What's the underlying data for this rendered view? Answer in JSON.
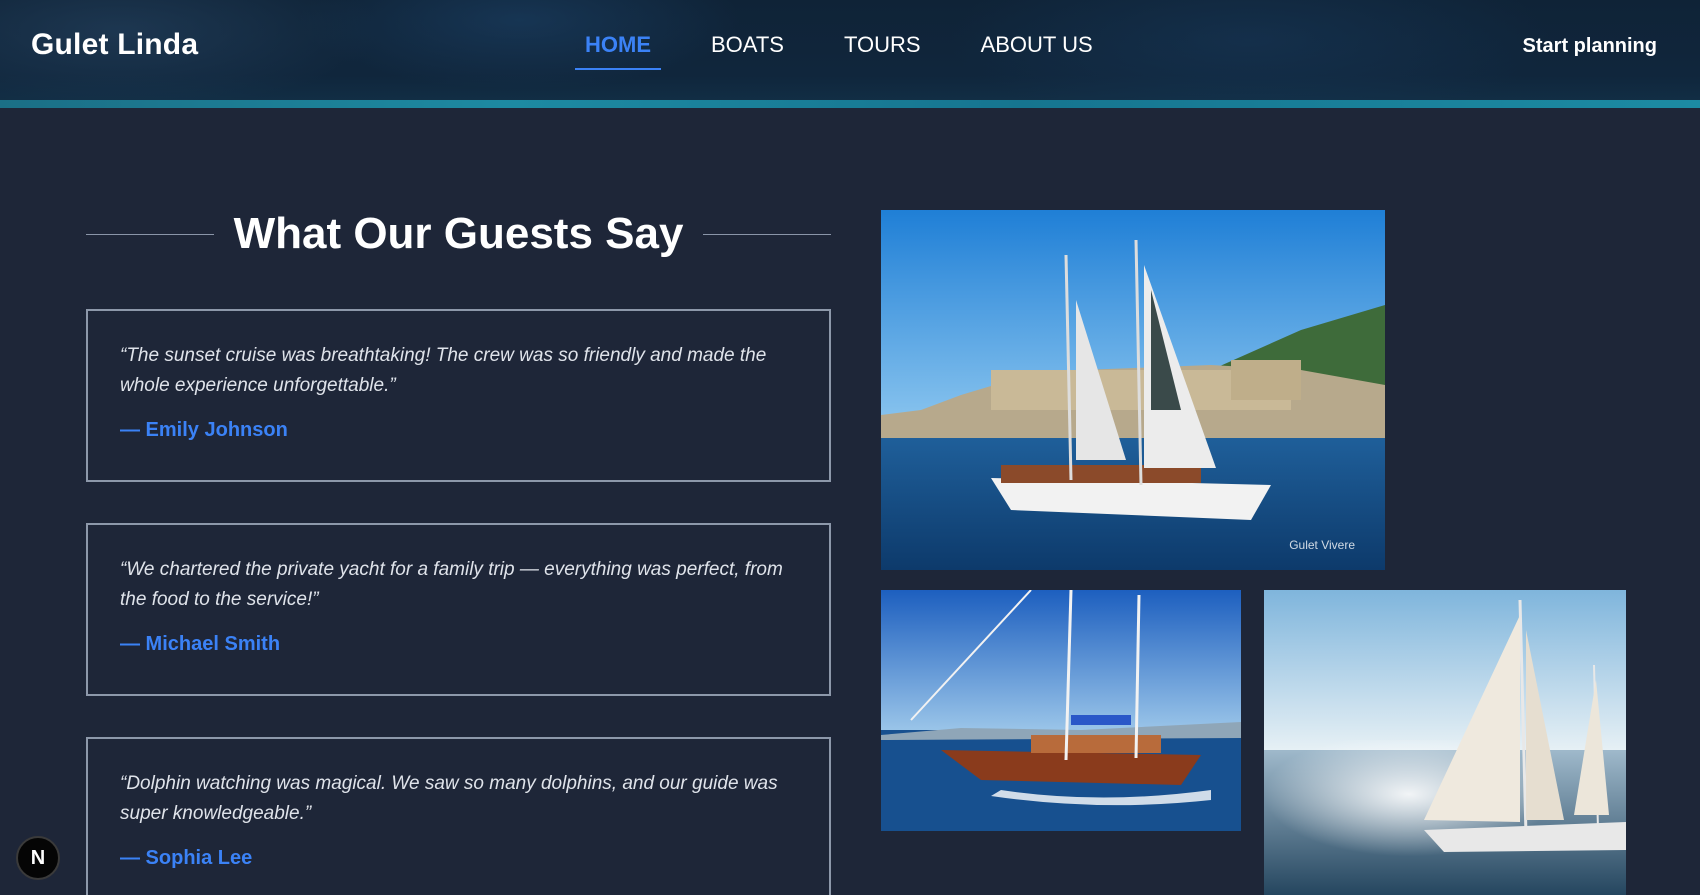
{
  "header": {
    "brand": "Gulet Linda",
    "nav": [
      {
        "label": "HOME",
        "active": true
      },
      {
        "label": "BOATS",
        "active": false
      },
      {
        "label": "TOURS",
        "active": false
      },
      {
        "label": "ABOUT US",
        "active": false
      }
    ],
    "cta_label": "Start planning"
  },
  "testimonials": {
    "heading": "What Our Guests Say",
    "items": [
      {
        "quote": "“The sunset cruise was breathtaking! The crew was so friendly and made the whole experience unforgettable.”",
        "author": "— Emily Johnson"
      },
      {
        "quote": "“We chartered the private yacht for a family trip — everything was perfect, from the food to the service!”",
        "author": "— Michael Smith"
      },
      {
        "quote": "“Dolphin watching was magical. We saw so many dolphins, and our guide was super knowledgeable.”",
        "author": "— Sophia Lee"
      }
    ]
  },
  "gallery": {
    "main_photo_caption": "Gulet Vivere"
  },
  "dev_badge": {
    "label": "N"
  },
  "colors": {
    "accent": "#3b82f6",
    "background": "#1e2638",
    "card_border": "#8d98aa"
  }
}
